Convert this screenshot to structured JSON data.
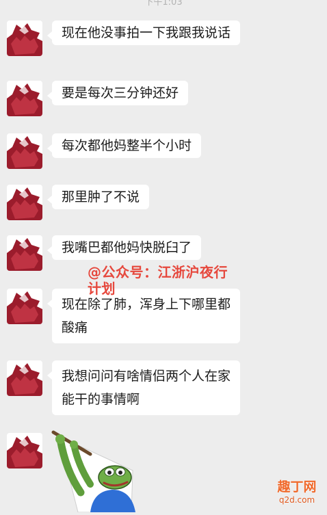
{
  "status": {
    "time": "下午1:03"
  },
  "messages": [
    {
      "text": "现在他没事拍一下我跟我说话"
    },
    {
      "text": "要是每次三分钟还好"
    },
    {
      "text": "每次都他妈整半个小时"
    },
    {
      "text": "那里肿了不说"
    },
    {
      "text": "我嘴巴都他妈快脱臼了"
    },
    {
      "lines": [
        "现在除了肺，浑身上下哪里都",
        "酸痛"
      ]
    },
    {
      "lines": [
        "我想问问有啥情侣两个人在家",
        "能干的事情啊"
      ]
    }
  ],
  "watermark": {
    "lines": [
      "@公众号：江浙沪夜行",
      "计划"
    ]
  },
  "site_mark": {
    "cn": "趣丁网",
    "en": "q2d.com"
  },
  "colors": {
    "background": "#ededed",
    "bubble": "#ffffff",
    "watermark": "#e6483d",
    "avatar_red": "#9b1c2c"
  },
  "sticker": {
    "icon": "pepe-frog-sticker"
  }
}
